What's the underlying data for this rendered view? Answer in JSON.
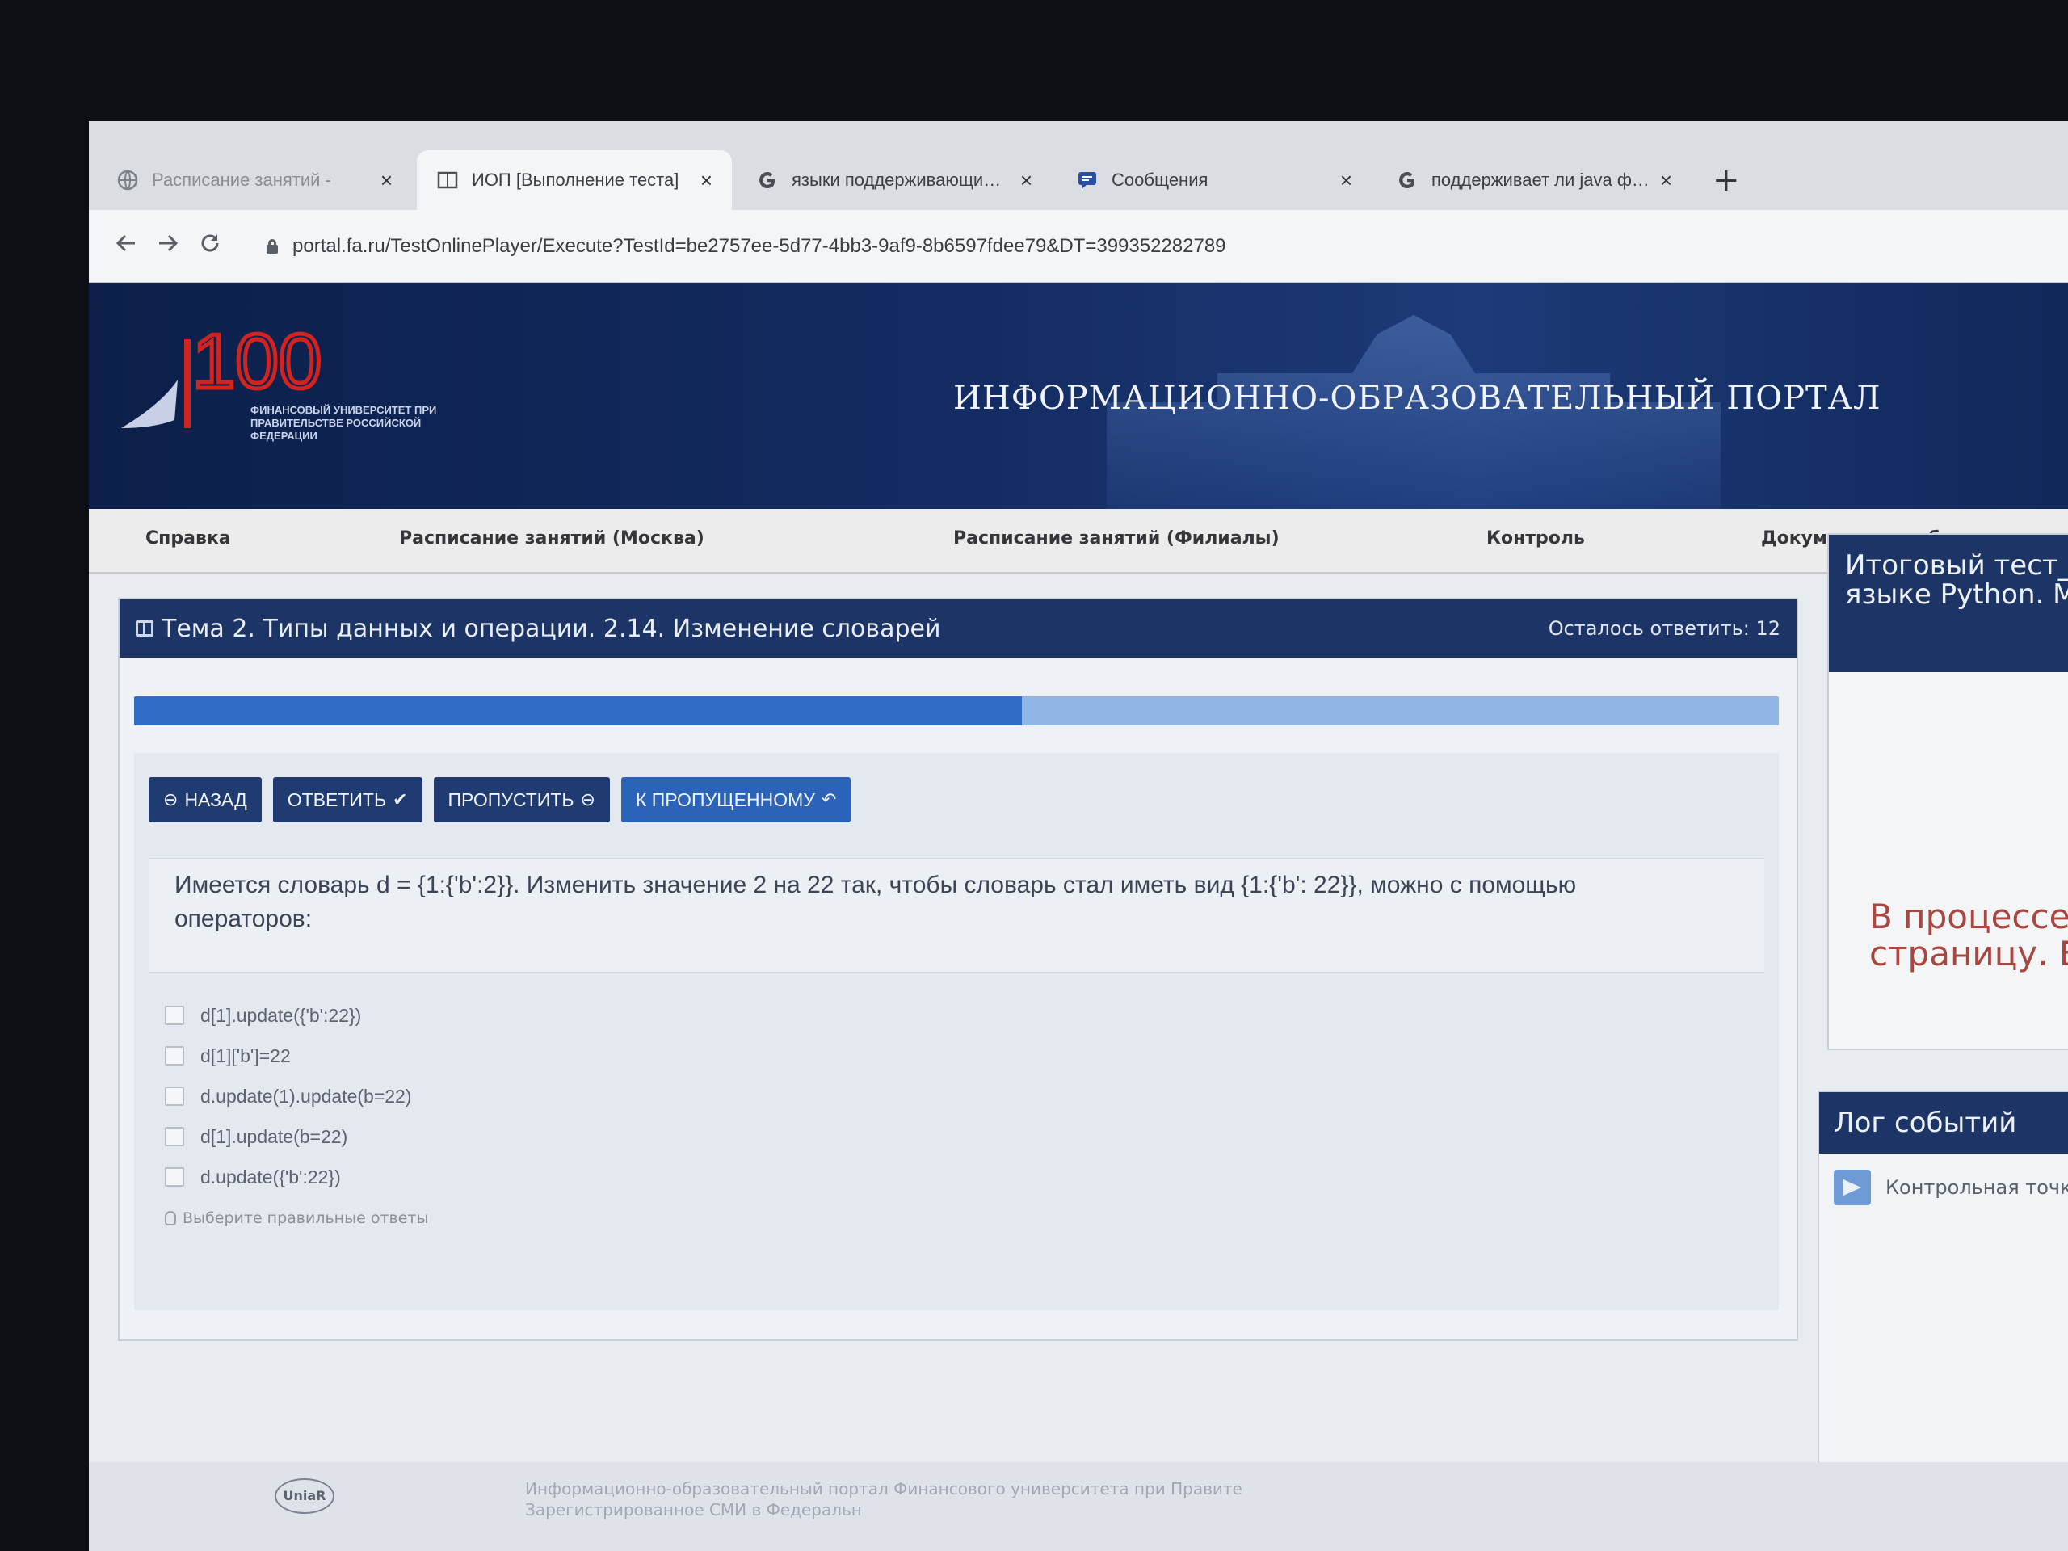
{
  "browser": {
    "tabs": [
      {
        "title": "Расписание занятий -",
        "icon": "globe-icon",
        "active": false,
        "faded": true
      },
      {
        "title": "ИОП [Выполнение теста]",
        "icon": "reader-icon",
        "active": true,
        "faded": false
      },
      {
        "title": "языки поддерживающие функ",
        "icon": "google-icon",
        "active": false,
        "faded": false
      },
      {
        "title": "Сообщения",
        "icon": "chat-icon",
        "active": false,
        "faded": false
      },
      {
        "title": "поддерживает ли java функцио",
        "icon": "google-icon",
        "active": false,
        "faded": false
      }
    ],
    "close_glyph": "×",
    "new_tab_glyph": "+",
    "url": "portal.fa.ru/TestOnlinePlayer/Execute?TestId=be2757ee-5d77-4bb3-9af9-8b6597fdee79&DT=399352282789"
  },
  "header": {
    "logo_number": "100",
    "logo_text": "ФИНАНСОВЫЙ УНИВЕРСИТЕТ ПРИ ПРАВИТЕЛЬСТВЕ РОССИЙСКОЙ ФЕДЕРАЦИИ",
    "title": "ИНФОРМАЦИОННО-ОБРАЗОВАТЕЛЬНЫЙ ПОРТАЛ"
  },
  "menu": {
    "items": [
      "Справка",
      "Расписание занятий (Москва)",
      "Расписание занятий (Филиалы)",
      "Контроль",
      "Документарная база"
    ]
  },
  "test": {
    "topic": "Тема 2. Типы данных и операции. 2.14. Изменение словарей",
    "remaining": "Осталось ответить: 12",
    "progress": 0.54,
    "buttons": {
      "back": "НАЗАД",
      "answer": "ОТВЕТИТЬ",
      "skip": "ПРОПУСТИТЬ",
      "to_skipped": "К ПРОПУЩЕННОМУ"
    },
    "question": "Имеется словарь d = {1:{'b':2}}. Изменить значение 2 на 22 так, чтобы словарь стал иметь вид {1:{'b': 22}}, можно с помощью операторов:",
    "options": [
      "d[1].update({'b':22})",
      "d[1]['b']=22",
      "d.update(1).update(b=22)",
      "d[1].update(b=22)",
      "d.update({'b':22})"
    ],
    "hint": "Выберите правильные ответы"
  },
  "sidebar": {
    "final_test_title_line1": "Итоговый тест_",
    "final_test_title_line2": "языке Python. М",
    "status_line1": "В процессе",
    "status_line2": "страницу. Е",
    "event_log_title": "Лог событий",
    "event_entry": "Контрольная точк"
  },
  "footer": {
    "logo": "UniaR",
    "line1": "Информационно-образовательный портал Финансового университета при Правите",
    "line2": "Зарегистрированное СМИ в Федеральн"
  },
  "colors": {
    "header_bg": "#142c63",
    "panel_head": "#1d3566",
    "progress_fill": "#2f6cc6",
    "progress_bg": "#8fb6e4",
    "status_text": "#a8463f",
    "logo_red": "#d2231e"
  }
}
